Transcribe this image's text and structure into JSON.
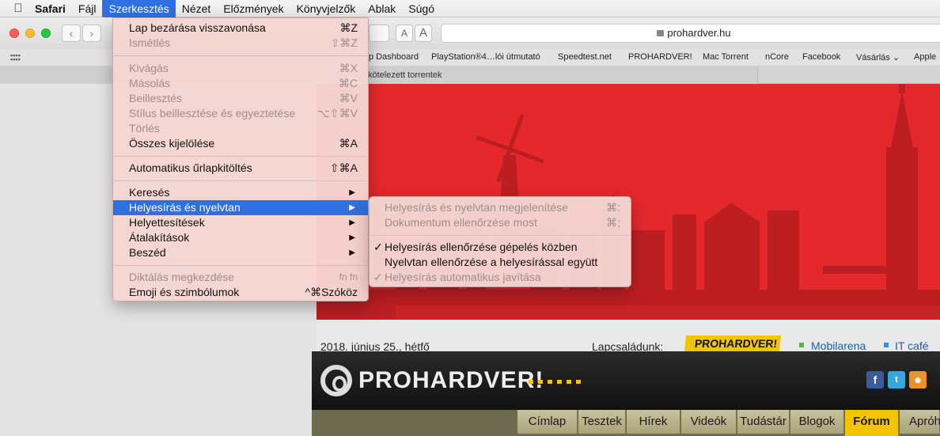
{
  "menubar": {
    "app": "Safari",
    "items": [
      "Fájl",
      "Szerkesztés",
      "Nézet",
      "Előzmények",
      "Könyvjelzők",
      "Ablak",
      "Súgó"
    ]
  },
  "toolbar": {
    "font_small": "A",
    "font_large": "A",
    "url": "prohardver.hu"
  },
  "bookmarks": [
    "p Dashboard",
    "PlayStation®4…lói útmutató",
    "Speedtest.net",
    "PROHARDVER!",
    "Mac Torrent",
    "nCore",
    "Facebook",
    "Vásárlás ⌄",
    "Apple"
  ],
  "tab": {
    "title": "kötelezett torrentek"
  },
  "edit_menu": {
    "items": [
      {
        "label": "Lap bezárása visszavonása",
        "shortcut": "⌘Z",
        "disabled": false
      },
      {
        "label": "Ismétlés",
        "shortcut": "⇧⌘Z",
        "disabled": true
      },
      {
        "label": "Kivágás",
        "shortcut": "⌘X",
        "disabled": true
      },
      {
        "label": "Másolás",
        "shortcut": "⌘C",
        "disabled": true
      },
      {
        "label": "Beillesztés",
        "shortcut": "⌘V",
        "disabled": true
      },
      {
        "label": "Stílus beillesztése és egyeztetése",
        "shortcut": "⌥⇧⌘V",
        "disabled": true
      },
      {
        "label": "Törlés",
        "shortcut": "",
        "disabled": true
      },
      {
        "label": "Összes kijelölése",
        "shortcut": "⌘A",
        "disabled": false
      },
      {
        "label": "Automatikus űrlapkitöltés",
        "shortcut": "⇧⌘A",
        "disabled": false
      },
      {
        "label": "Keresés",
        "submenu": true
      },
      {
        "label": "Helyesírás és nyelvtan",
        "submenu": true,
        "highlighted": true
      },
      {
        "label": "Helyettesítések",
        "submenu": true
      },
      {
        "label": "Átalakítások",
        "submenu": true
      },
      {
        "label": "Beszéd",
        "submenu": true
      },
      {
        "label": "Diktálás megkezdése",
        "shortcut": "fn fn",
        "disabled": true
      },
      {
        "label": "Emoji és szimbólumok",
        "shortcut": "^⌘Szóköz",
        "disabled": false
      }
    ]
  },
  "spelling_submenu": {
    "items": [
      {
        "label": "Helyesírás és nyelvtan megjelenítése",
        "shortcut": "⌘:",
        "disabled": true
      },
      {
        "label": "Dokumentum ellenőrzése most",
        "shortcut": "⌘;",
        "disabled": true
      },
      {
        "label": "Helyesírás ellenőrzése gépelés közben",
        "checked": true,
        "disabled": false
      },
      {
        "label": "Nyelvtan ellenőrzése a helyesírással együtt",
        "checked": false,
        "disabled": false
      },
      {
        "label": "Helyesírás automatikus javítása",
        "checked": true,
        "disabled": true
      }
    ],
    "check_mark": "✓"
  },
  "page": {
    "date": "2018. június 25., hétfő",
    "family_label": "Lapcsaládunk:",
    "family_sites": [
      "PROHARDVER!",
      "Mobilarena",
      "IT café"
    ],
    "logo_text": "PROHARDVER!",
    "social": [
      "f",
      "t",
      "rss"
    ],
    "nav_tabs": [
      "Címlap",
      "Tesztek",
      "Hírek",
      "Videók",
      "Tudástár",
      "Blogok",
      "Fórum",
      "Apróh"
    ],
    "active_tab": "Fórum"
  },
  "colors": {
    "menu_highlight": "#2f6fe0",
    "banner_red": "#e4282c",
    "brand_yellow": "#f2c500",
    "link_blue": "#1b5fa6"
  }
}
